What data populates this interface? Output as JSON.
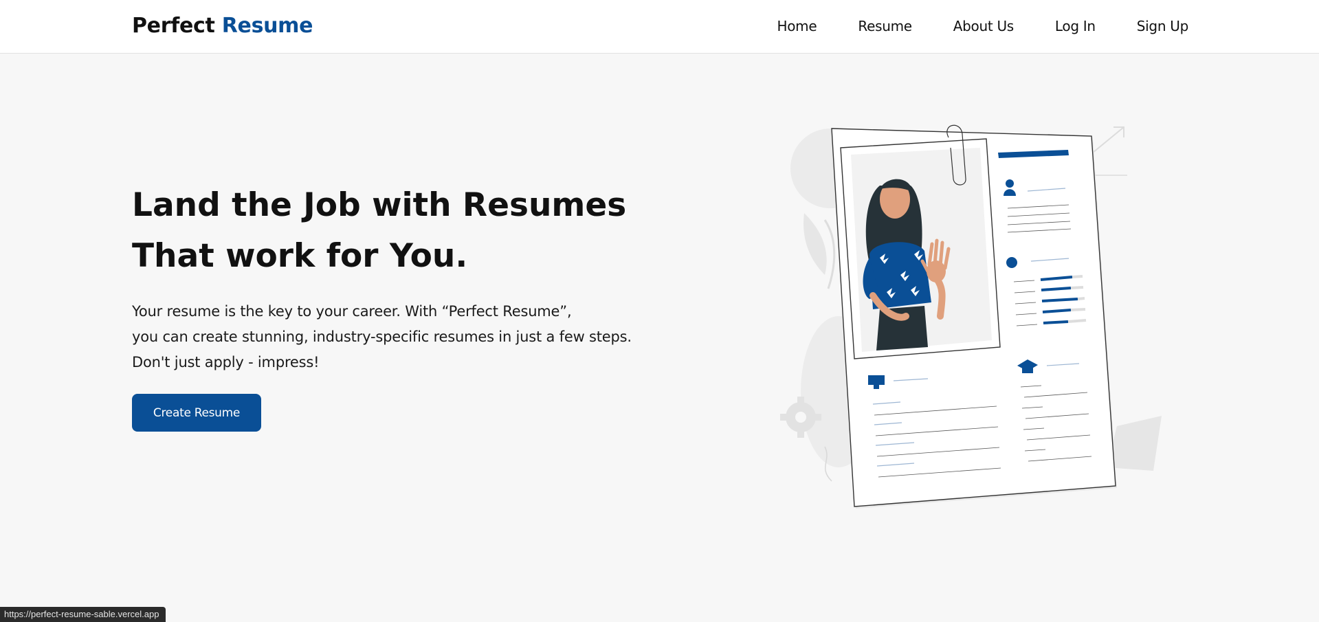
{
  "header": {
    "brand_part1": "Perfect",
    "brand_part2": "Resume",
    "nav": [
      "Home",
      "Resume",
      "About Us",
      "Log In",
      "Sign Up"
    ]
  },
  "hero": {
    "title_line1": "Land the Job with Resumes",
    "title_line2": "That work for You.",
    "desc_line1": "Your resume is the key to your career. With “Perfect Resume”,",
    "desc_line2": "you can create stunning, industry-specific resumes in just a few steps.",
    "desc_line3": "Don't just apply - impress!",
    "cta_label": "Create Resume"
  },
  "status_bar": {
    "url": "https://perfect-resume-sable.vercel.app"
  },
  "colors": {
    "brand_blue": "#0a4f96",
    "background": "#f7f7f7"
  }
}
